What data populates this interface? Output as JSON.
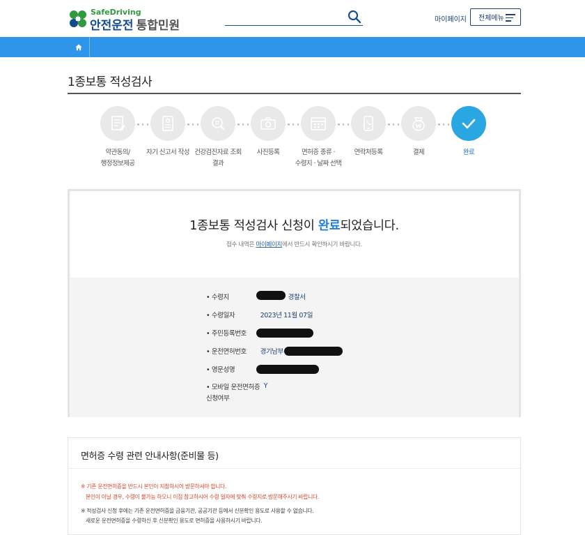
{
  "header": {
    "brand_en": "SafeDriving",
    "brand_ko": "안전운전",
    "brand_sub": "통합민원",
    "search_placeholder": "",
    "mypage_label": "마이페이지",
    "allmenu_label": "전체메뉴"
  },
  "page": {
    "title": "1종보통 적성검사"
  },
  "steps": [
    {
      "label": "약관동의/\n행정정보제공",
      "icon": "document-edit-icon",
      "done": false
    },
    {
      "label": "자기 신고서 작성",
      "icon": "form-icon",
      "done": false
    },
    {
      "label": "건강검진자료 조회\n결과",
      "icon": "magnifier-icon",
      "done": false
    },
    {
      "label": "사진등록",
      "icon": "camera-icon",
      "done": false
    },
    {
      "label": "면허증 종류 ·\n수령지 · 날짜 선택",
      "icon": "calendar-icon",
      "done": false
    },
    {
      "label": "연락처등록",
      "icon": "phone-icon",
      "done": false
    },
    {
      "label": "결제",
      "icon": "won-coin-icon",
      "done": false
    },
    {
      "label": "완료",
      "icon": "check-icon",
      "done": true
    }
  ],
  "result": {
    "title_before": "1종보통 적성검사 신청이 ",
    "title_highlight": "완료",
    "title_after": "되었습니다.",
    "note_before": "접수 내역은 ",
    "note_link": "마이페이지",
    "note_after": "에서 반드시 확인하시기 바랍니다.",
    "rows": [
      {
        "key": "수령지",
        "value": "경찰서"
      },
      {
        "key": "수령일자",
        "value": "2023년 11월 07일"
      },
      {
        "key": "주민등록번호",
        "value": ""
      },
      {
        "key": "운전면허번호",
        "value": "경기남부"
      },
      {
        "key": "영문성명",
        "value": ""
      },
      {
        "key": "모바일 운전면허증 신청여부",
        "value": "Y"
      }
    ]
  },
  "guide": {
    "title": "면허증 수령 관련 안내사항(준비물 등)",
    "lines": [
      "※ 기존 운전면허증을 반드시 본인이 지참하시어 방문하셔야 합니다.",
      "본인이 아닐 경우, 수령이 불가능 하오니 이점 참고하시어 수령 일자에 맞춰 수령지로 방문해주시기 바랍니다.",
      "※ 적성검사 신청 후에는 기존 운전면허증을 금융기관, 공공기관 등에서 신분확인 용도로 사용할 수 없습니다.",
      "새로운 운전면허증을 수령하신 후 신분확인 용도로 면허증을 사용하시기 바랍니다."
    ]
  },
  "colors": {
    "brand_green": "#2f9a3e",
    "brand_navy": "#124a8c",
    "nav_blue": "#2e95ea",
    "step_done": "#2aa6e3",
    "highlight": "#1e7fd8",
    "warning_red": "#d9452d"
  }
}
